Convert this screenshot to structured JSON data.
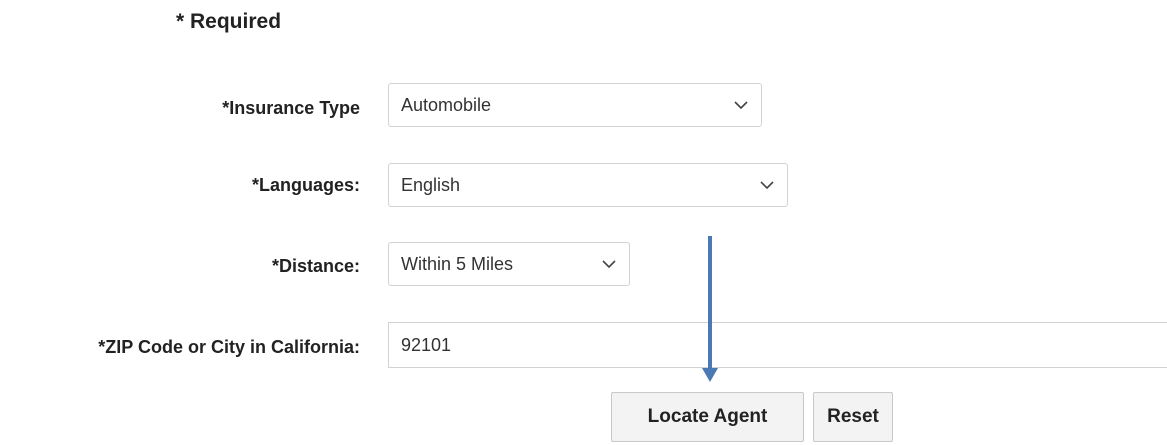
{
  "form": {
    "required_note": "* Required",
    "insurance_type": {
      "label": "*Insurance Type",
      "selected": "Automobile",
      "icon": "chevron-down-icon"
    },
    "languages": {
      "label": "*Languages:",
      "selected": "English",
      "icon": "chevron-down-icon"
    },
    "distance": {
      "label": "*Distance:",
      "selected": "Within 5 Miles",
      "icon": "chevron-down-icon"
    },
    "zip": {
      "label": "*ZIP Code or City in California:",
      "value": "92101"
    },
    "buttons": {
      "locate": "Locate Agent",
      "reset": "Reset"
    }
  },
  "annotation": {
    "icon": "down-arrow-icon",
    "color": "#4a79b3"
  },
  "colors": {
    "border": "#d2d2d2",
    "button_bg": "#f3f3f3",
    "text": "#222222"
  }
}
